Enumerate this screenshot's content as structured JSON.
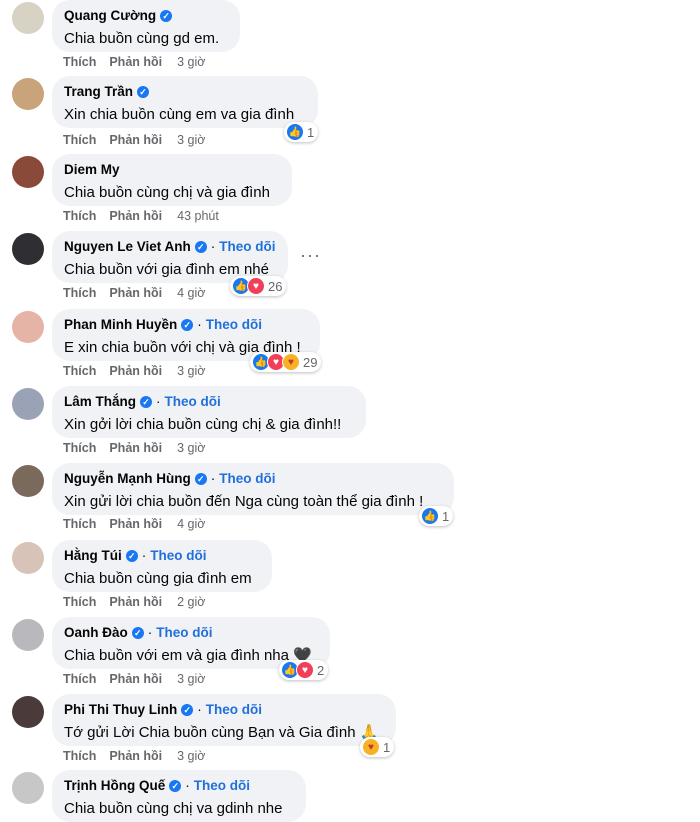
{
  "ui": {
    "like_label": "Thích",
    "reply_label": "Phản hồi",
    "follow_label": "Theo dõi",
    "more_icon": "···"
  },
  "comments": [
    {
      "name": "Quang Cường",
      "text": "Chia buồn cùng gd em.",
      "time": "3 giờ"
    },
    {
      "name": "Trang Trần",
      "text": "Xin chia buồn cùng em va gia đình",
      "time": "3 giờ",
      "reactions": "1"
    },
    {
      "name": "Diem My",
      "text": "Chia buồn cùng chị và gia đình",
      "time": "43 phút"
    },
    {
      "name": "Nguyen Le Viet Anh",
      "text": "Chia buồn với gia đình em nhé",
      "time": "4 giờ",
      "reactions": "26"
    },
    {
      "name": "Phan Minh Huyền",
      "text": "E xin chia buồn với chị và gia đình !",
      "time": "3 giờ",
      "reactions": "29"
    },
    {
      "name": "Lâm Thắng",
      "text": "Xin gởi lời chia buồn cùng chị & gia đình!!",
      "time": "3 giờ"
    },
    {
      "name": "Nguyễn Mạnh Hùng",
      "text": "Xin gửi lời chia buồn đến Nga cùng toàn thể gia đình !",
      "time": "4 giờ",
      "reactions": "1"
    },
    {
      "name": "Hằng Túi",
      "text": "Chia buồn cùng gia đình em",
      "time": "2 giờ"
    },
    {
      "name": "Oanh Đào",
      "text": "Chia buồn với em và gia đình nha 🖤",
      "time": "3 giờ",
      "reactions": "2"
    },
    {
      "name": "Phi Thi Thuy Linh",
      "text": "Tớ gửi Lời Chia buồn cùng Bạn và Gia đình 🙏",
      "time": "3 giờ",
      "reactions": "1"
    },
    {
      "name": "Trịnh Hồng Quế",
      "text": "Chia buồn cùng chị va gdinh nhe"
    }
  ]
}
